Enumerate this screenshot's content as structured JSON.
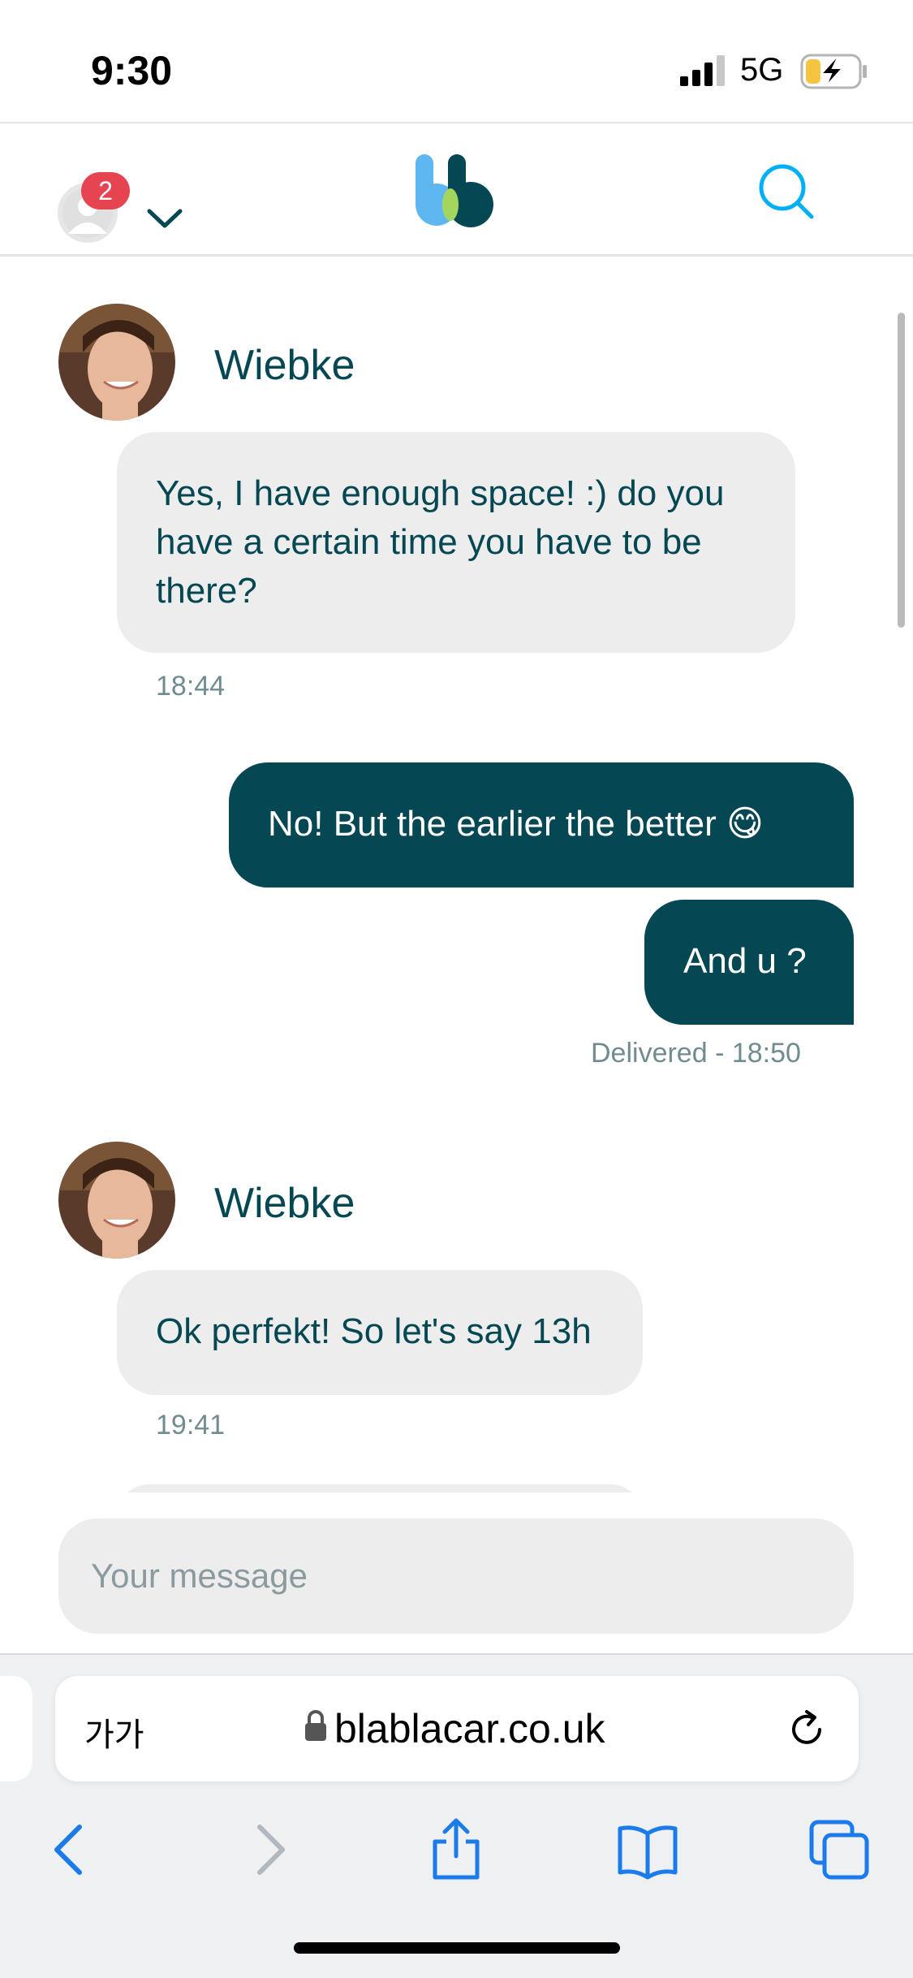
{
  "status_bar": {
    "time": "9:30",
    "network": "5G"
  },
  "header": {
    "notification_count": "2"
  },
  "messages": [
    {
      "sender": "Wiebke",
      "text": "Yes, I have enough space! :) do you have a certain time you have to be there?",
      "time": "18:44"
    },
    {
      "text": "No! But the earlier the better 😋"
    },
    {
      "text": "And u ?"
    },
    {
      "status": "Delivered - 18:50"
    },
    {
      "sender": "Wiebke",
      "text": "Ok perfekt! So let's say 13h",
      "time": "19:41"
    }
  ],
  "composer": {
    "placeholder": "Your message"
  },
  "browser": {
    "text_size_label": "가가",
    "url": "blablacar.co.uk"
  },
  "colors": {
    "brand_dark": "#054752",
    "bubble_in": "#ededed",
    "accent_blue": "#00aff5",
    "badge_red": "#e64451"
  }
}
